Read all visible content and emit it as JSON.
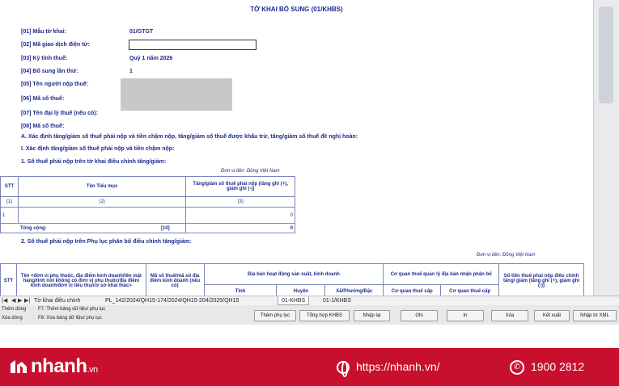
{
  "form": {
    "title": "TỜ KHAI BỔ SUNG (01/KHBS)",
    "fields": [
      {
        "label": "[01] Mẫu tờ khai:",
        "value": "01/GTGT"
      },
      {
        "label": "[02] Mã giao dịch điện tử:",
        "value": ""
      },
      {
        "label": "[03] Kỳ tính thuế:",
        "value": "Quý 1 năm 2026"
      },
      {
        "label": "[04] Bổ sung lần thứ:",
        "value": "1"
      },
      {
        "label": "[05] Tên người nộp thuế:",
        "value": ""
      },
      {
        "label": "[06] Mã số thuế:",
        "value": ""
      },
      {
        "label": "[07] Tên đại lý thuế (nếu có):",
        "value": ""
      },
      {
        "label": "[08] Mã số thuế:",
        "value": ""
      }
    ],
    "section_a": "A. Xác định tăng/giảm số thuế phải nộp và tiền chậm nộp, tăng/giảm số thuế được khấu trừ, tăng/giảm số thuế đề nghị hoàn:",
    "section_i": "I. Xác định tăng/giảm số thuế phải nộp và tiền chậm nộp:",
    "section_1": "1. Số thuế phải nộp trên tờ khai điều chỉnh tăng/giảm:",
    "unit_1": "Đơn vị tiền: Đồng Việt Nam",
    "table1": {
      "headers": [
        "STT",
        "Tên Tiểu mục",
        "Tăng/giảm số thuế phải nộp (tăng ghi (+), giảm ghi (-))"
      ],
      "index_row": [
        "(1)",
        "(2)",
        "(3)"
      ],
      "row": [
        "1",
        "",
        "0"
      ],
      "total_label": "Tổng cộng:",
      "total_code": "[10]",
      "total_value": "0"
    },
    "section_2": "2. Số thuế phải nộp trên Phụ lục phân bổ điều chỉnh tăng/giảm:",
    "unit_2": "Đơn vị tiền: Đồng Việt Nam",
    "table2": {
      "h_stt": "STT",
      "h_name": "Tên <đơn vị phụ thuộc, địa điểm kinh doanh/tên mặt hàng/tỉnh nơi không có đơn vị phụ thuộc/địa điểm kinh doanh/đơn vị tiêu thụ/cơ sở khai thác>",
      "h_mst": "Mã số thuế/mã số địa điểm kinh doanh (nếu có)",
      "h_area": "Địa bàn hoạt động sản xuất, kinh doanh",
      "h_tinh": "Tỉnh",
      "h_huyen": "Huyện",
      "h_xa": "Xã/Phường/Đặc",
      "h_cq": "Cơ quan thuế quản lý địa bàn nhận phân bổ",
      "h_cq1": "Cơ quan thuế cấp",
      "h_cq2": "Cơ quan thuế cấp",
      "h_sotien": "Số tiền thuế phải nộp điều chỉnh tăng/ giảm (tăng ghi (+), giảm ghi (-))"
    }
  },
  "sheet_tabs": {
    "items": [
      "Tờ khai điều chỉnh",
      "PL_142/2024/QH15-174/2024/QH15-204/2025/QH15",
      "01-KHBS",
      "01-1/KHBS"
    ],
    "active": "01-KHBS"
  },
  "status": {
    "line1_left": "Thêm dòng",
    "line1_key": "F7: Thêm bảng dữ liệu/ phụ lục",
    "line2_left": "Xóa dòng",
    "line2_key": "F8: Xóa bảng dữ liệu/ phụ lục"
  },
  "buttons": [
    "Thêm phụ lục",
    "Tổng hợp KHBS",
    "Nhập lại",
    "Ghi",
    "In",
    "Xóa",
    "Kết xuất",
    "Nhập từ XML"
  ],
  "banner": {
    "brand": "nhanh",
    "brand_suffix": ".vn",
    "website": "https://nhanh.vn/",
    "phone": "1900 2812"
  },
  "colors": {
    "banner": "#c8102e",
    "form_text": "#1e2a8a"
  }
}
